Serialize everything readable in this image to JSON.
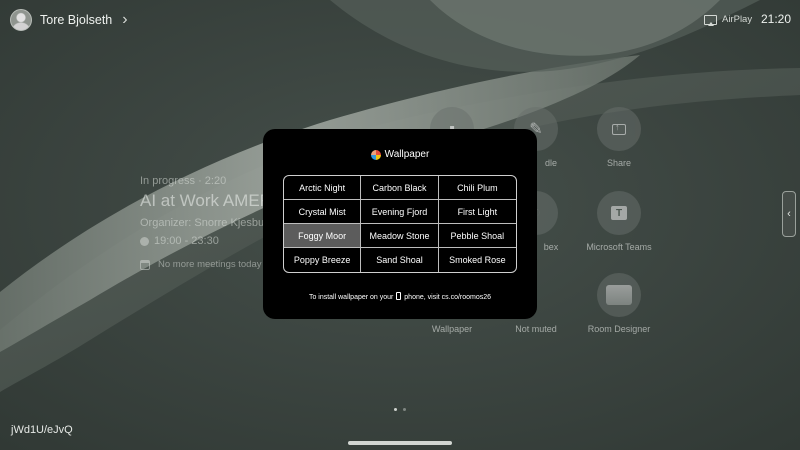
{
  "header": {
    "user_name": "Tore Bjolseth",
    "airplay_label": "AirPlay",
    "time": "21:20"
  },
  "meeting": {
    "status": "In progress · 2:20",
    "title": "AI at Work AMER",
    "organizer": "Organizer: Snorre Kjesbu",
    "time_range": "19:00 - 23:30",
    "no_more_meetings": "No more meetings today"
  },
  "apps": [
    {
      "label": "",
      "icon": "camera-icon"
    },
    {
      "label": "dle",
      "icon": "pencil-icon"
    },
    {
      "label": "Share",
      "icon": "share-icon"
    },
    {
      "label": "bex",
      "icon": "webex-icon"
    },
    {
      "label": "Microsoft Teams",
      "icon": "teams-icon"
    },
    {
      "label": "Wallpaper",
      "icon": "wallpaper-icon"
    },
    {
      "label": "Not muted",
      "icon": "microphone-icon"
    },
    {
      "label": "Room Designer",
      "icon": "room-designer-icon"
    }
  ],
  "wallpaper_modal": {
    "title": "Wallpaper",
    "selected": "Foggy Moor",
    "options": [
      "Arctic Night",
      "Carbon Black",
      "Chili Plum",
      "Crystal Mist",
      "Evening Fjord",
      "First Light",
      "Foggy Moor",
      "Meadow Stone",
      "Pebble Shoal",
      "Poppy Breeze",
      "Sand Shoal",
      "Smoked Rose"
    ],
    "footer_before": "To install wallpaper on your",
    "footer_after": "phone, visit cs.co/roomos26"
  },
  "footer": {
    "pairing_code": "jWd1U/eJvQ"
  },
  "colors": {
    "background": "#3b4440",
    "modal_background": "#000000",
    "selected_cell": "#5c5c5c"
  }
}
